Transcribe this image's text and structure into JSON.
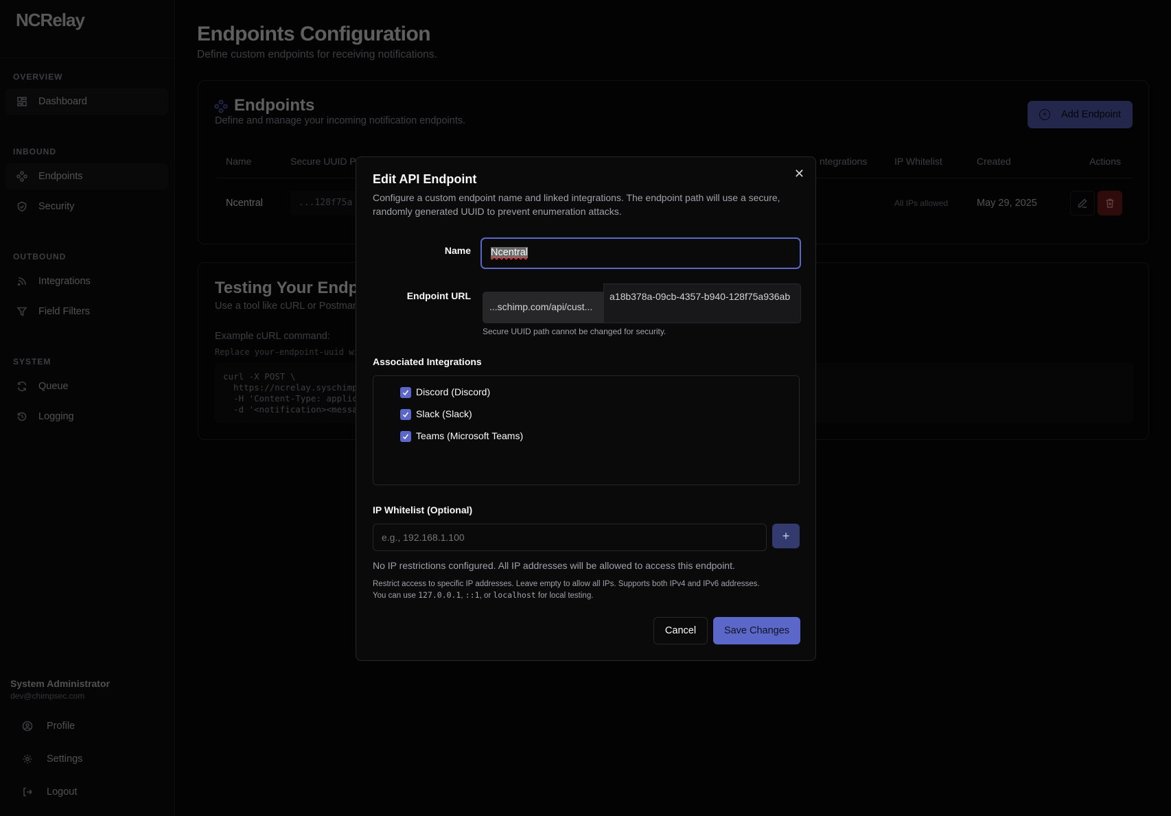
{
  "app": {
    "brand": "NCRelay"
  },
  "sidebar": {
    "sections": [
      {
        "label": "OVERVIEW",
        "items": [
          {
            "label": "Dashboard",
            "icon": "dashboard-icon"
          }
        ]
      },
      {
        "label": "INBOUND",
        "items": [
          {
            "label": "Endpoints",
            "icon": "endpoints-icon"
          },
          {
            "label": "Security",
            "icon": "shield-icon"
          }
        ]
      },
      {
        "label": "OUTBOUND",
        "items": [
          {
            "label": "Integrations",
            "icon": "rss-icon"
          },
          {
            "label": "Field Filters",
            "icon": "filter-icon"
          }
        ]
      },
      {
        "label": "SYSTEM",
        "items": [
          {
            "label": "Queue",
            "icon": "refresh-icon"
          },
          {
            "label": "Logging",
            "icon": "history-icon"
          }
        ]
      }
    ],
    "user": {
      "name": "System Administrator",
      "email": "dev@chimpsec.com"
    },
    "footer": [
      {
        "label": "Profile"
      },
      {
        "label": "Settings"
      },
      {
        "label": "Logout"
      }
    ]
  },
  "page": {
    "title": "Endpoints Configuration",
    "subtitle": "Define custom endpoints for receiving notifications."
  },
  "endpoints_card": {
    "title": "Endpoints",
    "subtitle": "Define and manage your incoming notification endpoints.",
    "add_button": "Add Endpoint",
    "columns": [
      "Name",
      "Secure UUID P",
      "ntegrations",
      "IP Whitelist",
      "Created",
      "Actions"
    ],
    "rows": [
      {
        "name": "Ncentral",
        "uuid": "...128f75a",
        "ip": "All IPs allowed",
        "created": "May 29, 2025"
      }
    ]
  },
  "testing_card": {
    "title": "Testing Your Endpoi",
    "subtitle": "Use a tool like cURL or Postman",
    "example_label": "Example cURL command:",
    "replace_note": "Replace your-endpoint-uuid with",
    "code": [
      "curl -X POST \\",
      "  https://ncrelay.syschimp.",
      "  -H 'Content-Type: applica",
      "  -d '<notification><messag"
    ]
  },
  "modal": {
    "title": "Edit API Endpoint",
    "description": "Configure a custom endpoint name and linked integrations. The endpoint path will use a secure, randomly generated UUID to prevent enumeration attacks.",
    "name_label": "Name",
    "name_value": "Ncentral",
    "url_label": "Endpoint URL",
    "url_prefix": "...schimp.com/api/cust...",
    "url_uuid": "a18b378a-09cb-4357-b940-128f75a936ab",
    "url_help": "Secure UUID path cannot be changed for security.",
    "integrations_label": "Associated Integrations",
    "integrations": [
      {
        "label": "Discord (Discord)",
        "checked": true
      },
      {
        "label": "Slack (Slack)",
        "checked": true
      },
      {
        "label": "Teams (Microsoft Teams)",
        "checked": true
      }
    ],
    "ip_label": "IP Whitelist (Optional)",
    "ip_placeholder": "e.g., 192.168.1.100",
    "add_ip": "+",
    "ip_status": "No IP restrictions configured. All IP addresses will be allowed to access this endpoint.",
    "ip_help_1": "Restrict access to specific IP addresses. Leave empty to allow all IPs. Supports both IPv4 and IPv6 addresses.",
    "ip_help_2a": "You can use ",
    "ip_code_1": "127.0.0.1",
    "ip_sep_1": ", ",
    "ip_code_2": "::1",
    "ip_sep_2": ", or ",
    "ip_code_3": "localhost",
    "ip_help_2b": " for local testing.",
    "cancel": "Cancel",
    "save": "Save Changes"
  },
  "colors": {
    "accent": "#5b67c9",
    "danger": "#7f1d1d",
    "background": "#09090b"
  }
}
